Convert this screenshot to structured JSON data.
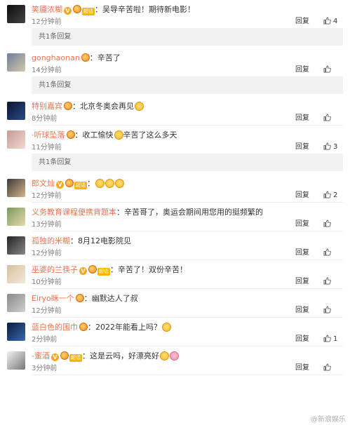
{
  "reply_label": "回复",
  "comments": [
    {
      "user": "笑靥浓糊",
      "v": true,
      "medal": true,
      "badge": "超话",
      "text": "：吴导辛苦啦！期待新电影！",
      "emojis": [],
      "time": "12分钟前",
      "likes": "4",
      "sub": "共1条回复",
      "avatar": [
        "#0d0d0d",
        "#444"
      ]
    },
    {
      "user": "gonghaonan",
      "v": false,
      "medal": true,
      "badge": "",
      "text": "：辛苦了",
      "emojis": [],
      "time": "14分钟前",
      "likes": "",
      "sub": "共1条回复",
      "avatar": [
        "#6d7f96",
        "#d6c7ad"
      ]
    },
    {
      "user": "特别嘉宾",
      "v": false,
      "medal": true,
      "badge": "",
      "text": "：北京冬奥会再见",
      "emojis": [
        "face"
      ],
      "time": "8分钟前",
      "likes": "",
      "sub": "",
      "avatar": [
        "#0b1530",
        "#2a4a8a"
      ]
    },
    {
      "user": "·听球坠落",
      "v": false,
      "medal": true,
      "badge": "",
      "text": "：收工愉快",
      "emojis": [
        "face"
      ],
      "text2": "辛苦了这么多天",
      "time": "11分钟前",
      "likes": "3",
      "sub": "共1条回复",
      "avatar": [
        "#c79a9a",
        "#f0d8d0"
      ]
    },
    {
      "user": "郎文灿",
      "v": true,
      "medal": true,
      "badge": "超话",
      "text": "：",
      "emojis": [
        "face",
        "face",
        "face"
      ],
      "time": "12分钟前",
      "likes": "2",
      "sub": "",
      "avatar": [
        "#3a3a3a",
        "#d8b488"
      ]
    },
    {
      "user": "义务教育课程便携背题本",
      "v": false,
      "medal": false,
      "badge": "",
      "text": "：辛苦哥了，奥运会期间用您用的挺频繁的",
      "emojis": [],
      "time": "13分钟前",
      "likes": "",
      "sub": "",
      "avatar": [
        "#7a9a5a",
        "#e8d8b0"
      ]
    },
    {
      "user": "孤独的米糊",
      "v": false,
      "medal": false,
      "badge": "",
      "text": "：8月12电影院见",
      "emojis": [],
      "time": "12分钟前",
      "likes": "",
      "sub": "",
      "avatar": [
        "#222",
        "#888"
      ]
    },
    {
      "user": "巫婆的兰筷子",
      "v": true,
      "medal": true,
      "badge": "超话",
      "text": "：辛苦了！双份辛苦！",
      "emojis": [],
      "time": "10分钟前",
      "likes": "",
      "sub": "",
      "avatar": [
        "#d8c0a0",
        "#f3e8d8"
      ]
    },
    {
      "user": "Eiryo眯一个",
      "v": false,
      "medal": true,
      "badge": "",
      "text": "：幽默达人了叔",
      "emojis": [],
      "time": "12分钟前",
      "likes": "",
      "sub": "",
      "avatar": [
        "#8a8a8a",
        "#cfcfcf"
      ]
    },
    {
      "user": "蓝白色的围巾",
      "v": false,
      "medal": true,
      "badge": "",
      "text": "：2022年能看上吗？",
      "emojis": [
        "face"
      ],
      "time": "2分钟前",
      "likes": "1",
      "sub": "",
      "avatar": [
        "#0a1a3a",
        "#3a6ab0"
      ]
    },
    {
      "user": "-蜜酒",
      "v": true,
      "medal": true,
      "badge": "超话",
      "text": "：这是云吗，好漂亮好",
      "emojis": [
        "face",
        "pig"
      ],
      "time": "3分钟前",
      "likes": "",
      "sub": "",
      "avatar": [
        "#f2f2f2",
        "#777"
      ]
    }
  ],
  "watermark": "@新浪娱乐"
}
